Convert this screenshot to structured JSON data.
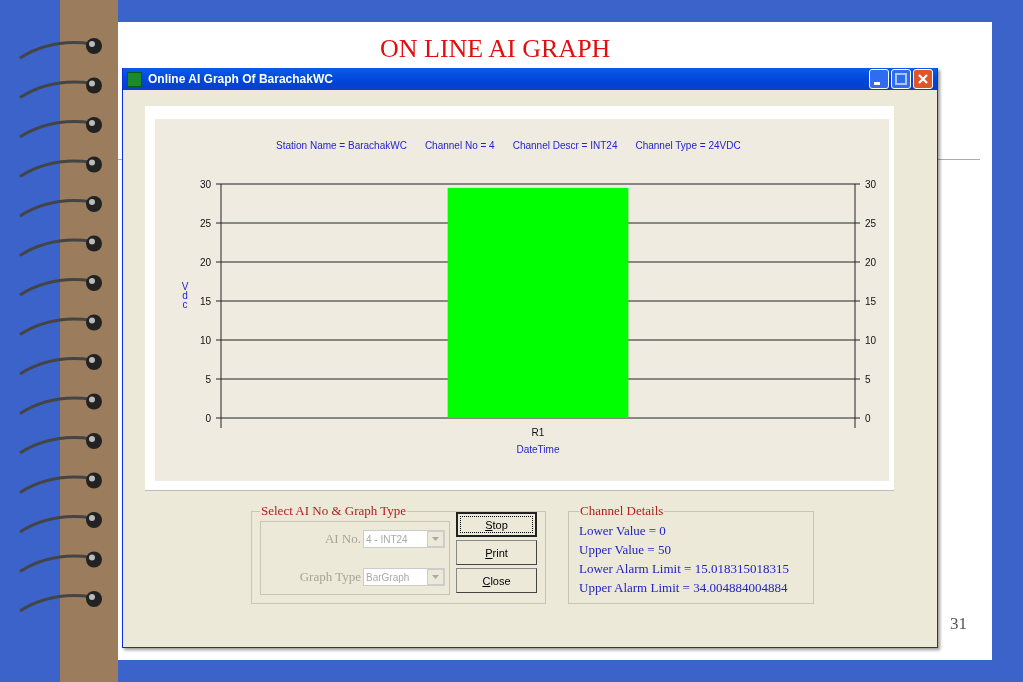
{
  "slide": {
    "title": "ON LINE AI GRAPH",
    "page_number": "31"
  },
  "window": {
    "title": "Online AI Graph Of  BarachakWC"
  },
  "graph": {
    "header": [
      "Station Name = BarachakWC",
      "Channel No = 4",
      "Channel Descr = INT24",
      "Channel Type = 24VDC"
    ],
    "chart_data": {
      "type": "bar",
      "xlabel": "DateTime",
      "ylabel": "Vdc",
      "categories": [
        "R1"
      ],
      "series": [
        {
          "color": "#00ff00",
          "values": [
            29.5
          ]
        }
      ],
      "ylim": [
        0,
        30
      ],
      "yticks": [
        0,
        5,
        10,
        15,
        20,
        25,
        30
      ],
      "grid": true
    },
    "right_axis_labels": [
      "30",
      "25",
      "20",
      "15",
      "10",
      "5",
      "0"
    ]
  },
  "select_group": {
    "title": "Select AI No & Graph Type",
    "disabled": true,
    "fields": [
      {
        "label": "AI No.",
        "value": "4 - INT24"
      },
      {
        "label": "Graph Type",
        "value": "BarGraph"
      }
    ],
    "buttons": [
      {
        "label": "Stop",
        "focused": true
      },
      {
        "label": "Print",
        "focused": false
      },
      {
        "label": "Close",
        "focused": false
      }
    ]
  },
  "channel_details": {
    "title": "Channel Details",
    "lines": [
      "Lower Value = 0",
      "Upper Value = 50",
      "Lower Alarm Limit = 15.018315018315",
      "Upper Alarm Limit = 34.004884004884"
    ]
  }
}
